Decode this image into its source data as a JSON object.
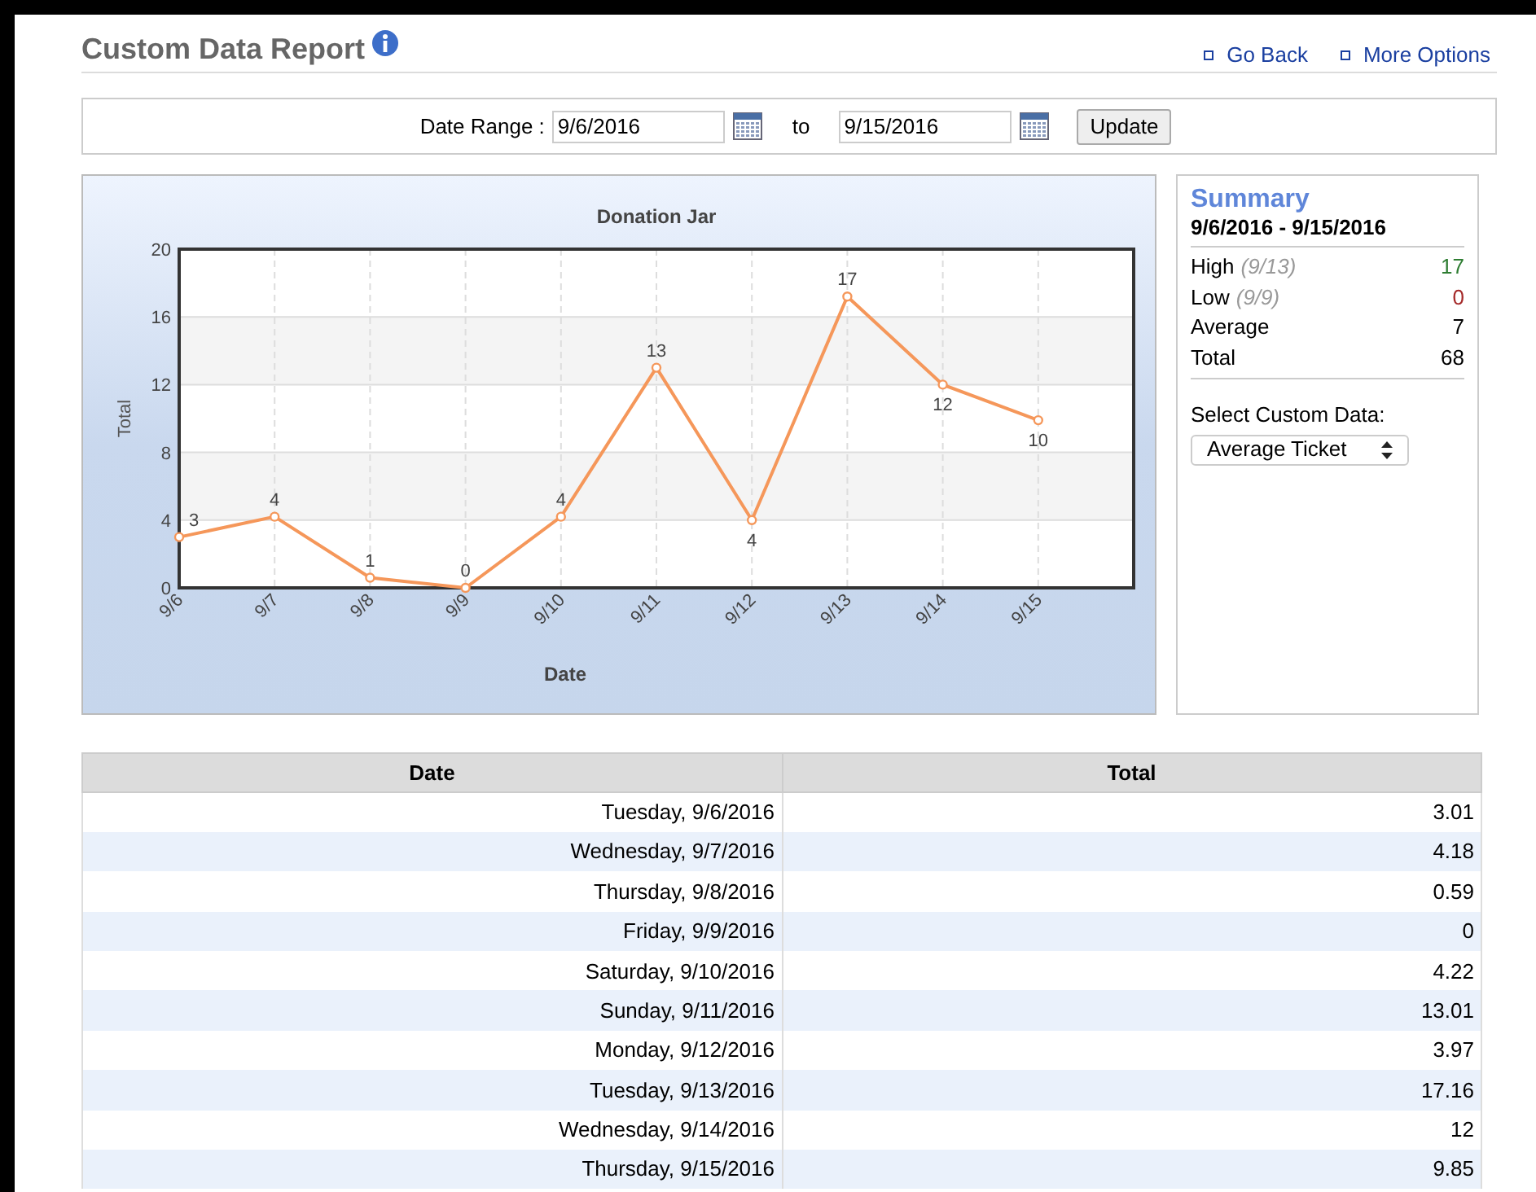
{
  "header": {
    "title": "Custom Data Report",
    "links": [
      "Go Back",
      "More Options"
    ]
  },
  "date_range": {
    "label": "Date Range :",
    "from": "9/6/2016",
    "separator": "to",
    "to": "9/15/2016",
    "button": "Update"
  },
  "chart": {
    "chart_data": {
      "type": "line",
      "title": "Donation Jar",
      "xlabel": "Date",
      "ylabel": "Total",
      "categories": [
        "9/6",
        "9/7",
        "9/8",
        "9/9",
        "9/10",
        "9/11",
        "9/12",
        "9/13",
        "9/14",
        "9/15"
      ],
      "series": [
        {
          "color": "#f5975a",
          "marker": true,
          "values": [
            3,
            4.2,
            0.6,
            0,
            4.2,
            13,
            4,
            17.2,
            12,
            9.9
          ]
        }
      ],
      "grid": true,
      "ylim": [
        0,
        20
      ],
      "yticks": [
        0,
        4,
        8,
        12,
        16,
        20
      ],
      "value_labels": [
        "3",
        "4",
        "1",
        "0",
        "4",
        "13",
        "4",
        "17",
        "12",
        "10"
      ]
    }
  },
  "summary": {
    "title": "Summary",
    "range": "9/6/2016 - 9/15/2016",
    "stats": [
      {
        "label": "High",
        "date": "(9/13)",
        "value": "17",
        "color": "#2e7d32"
      },
      {
        "label": "Low",
        "date": "(9/9)",
        "value": "0",
        "color": "#a52a2a"
      },
      {
        "label": "Average",
        "value": "7",
        "color": "#000000"
      },
      {
        "label": "Total",
        "value": "68",
        "color": "#000000"
      }
    ],
    "select_label": "Select Custom Data:",
    "select_value": "Average Ticket"
  },
  "table": {
    "columns": [
      "Date",
      "Total"
    ],
    "rows": [
      [
        "Tuesday, 9/6/2016",
        "3.01"
      ],
      [
        "Wednesday, 9/7/2016",
        "4.18"
      ],
      [
        "Thursday, 9/8/2016",
        "0.59"
      ],
      [
        "Friday, 9/9/2016",
        "0"
      ],
      [
        "Saturday, 9/10/2016",
        "4.22"
      ],
      [
        "Sunday, 9/11/2016",
        "13.01"
      ],
      [
        "Monday, 9/12/2016",
        "3.97"
      ],
      [
        "Tuesday, 9/13/2016",
        "17.16"
      ],
      [
        "Wednesday, 9/14/2016",
        "12"
      ],
      [
        "Thursday, 9/15/2016",
        "9.85"
      ]
    ]
  }
}
